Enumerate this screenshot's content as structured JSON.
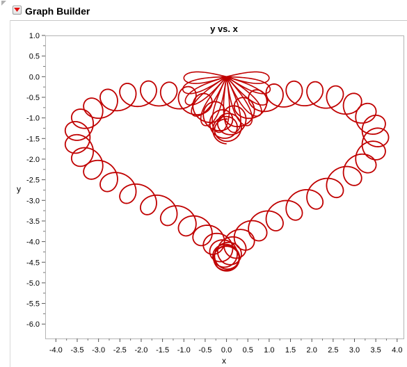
{
  "window": {
    "title": "Graph Builder"
  },
  "chart_data": {
    "type": "line",
    "title": "y vs. x",
    "xlabel": "x",
    "ylabel": "y",
    "xlim": [
      -4.25,
      4.15
    ],
    "ylim": [
      -6.35,
      1.0
    ],
    "xticks": [
      -4.0,
      -3.5,
      -3.0,
      -2.5,
      -2.0,
      -1.5,
      -1.0,
      -0.5,
      0.0,
      0.5,
      1.0,
      1.5,
      2.0,
      2.5,
      3.0,
      3.5,
      4.0
    ],
    "xtick_labels": [
      "-4.0",
      "-3.5",
      "-3.0",
      "-2.5",
      "-2.0",
      "-1.5",
      "-1.0",
      "-0.5",
      "0.0",
      "0.5",
      "1.0",
      "1.5",
      "2.0",
      "2.5",
      "3.0",
      "3.5",
      "4.0"
    ],
    "yticks": [
      1.0,
      0.5,
      0.0,
      -0.5,
      -1.0,
      -1.5,
      -2.0,
      -2.5,
      -3.0,
      -3.5,
      -4.0,
      -4.5,
      -5.0,
      -5.5,
      -6.0
    ],
    "ytick_labels": [
      "1.0",
      "0.5",
      "0.0",
      "-0.5",
      "-1.0",
      "-1.5",
      "-2.0",
      "-2.5",
      "-3.0",
      "-3.5",
      "-4.0",
      "-4.5",
      "-5.0",
      "-5.5",
      "-6.0"
    ],
    "grid": false,
    "legend": false,
    "series_color": "#c00000",
    "series": [
      {
        "outer_loop": {
          "t_range": [
            0.15,
            6.133
          ],
          "x": "3.5*sin(t)^3 + 0.3*cos(52*t)",
          "y": "(3.25*cos(t) - 1.3*cos(2*t) - 0.5*cos(3*t) - 0.25*cos(4*t))*0.55 - 2.05 + 0.3*sin(52*t)"
        },
        "inner_bundle": {
          "petals": 12,
          "angle_range_deg": [
            -88,
            88
          ],
          "reach_range": [
            1.0,
            1.4
          ],
          "width_fraction": 0.28
        }
      }
    ]
  }
}
